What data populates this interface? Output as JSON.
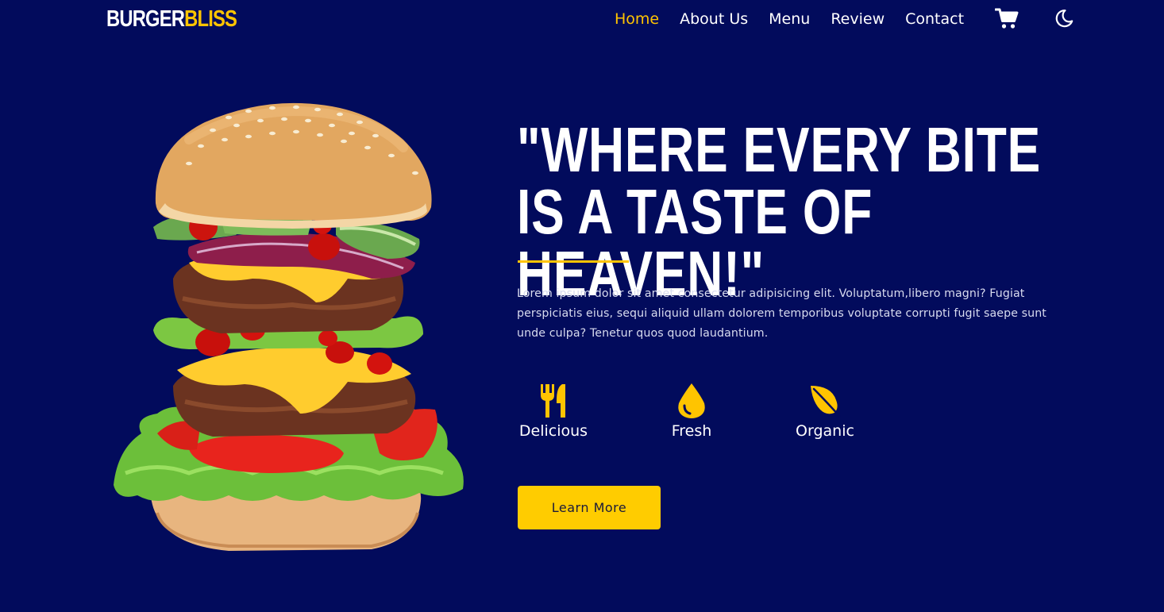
{
  "brand": {
    "name_part1": "BURGER",
    "name_part2": "BLISS",
    "primary_color": "#ffffff",
    "accent_color": "#ffc400"
  },
  "nav": {
    "links": [
      {
        "label": "Home",
        "active": true
      },
      {
        "label": "About Us",
        "active": false
      },
      {
        "label": "Menu",
        "active": false
      },
      {
        "label": "Review",
        "active": false
      },
      {
        "label": "Contact",
        "active": false
      }
    ],
    "cart_icon": "shopping-cart-icon",
    "theme_icon": "moon-icon"
  },
  "hero": {
    "title": "\"WHERE EVERY BITE IS A TASTE OF HEAVEN!\"",
    "description": "Lorem ipsum dolor sit amet consectetur adipisicing elit. Voluptatum,libero magni? Fugiat perspiciatis eius, sequi aliquid ullam dolorem temporibus voluptate corrupti fugit saepe sunt unde culpa? Tenetur quos quod laudantium.",
    "features": [
      {
        "label": "Delicious",
        "icon": "utensils-icon"
      },
      {
        "label": "Fresh",
        "icon": "droplet-icon"
      },
      {
        "label": "Organic",
        "icon": "leaf-icon"
      }
    ],
    "cta_label": "Learn More",
    "image": "burger-image"
  },
  "colors": {
    "background": "#020b5c",
    "accent": "#ffc400",
    "button": "#ffcc00"
  }
}
